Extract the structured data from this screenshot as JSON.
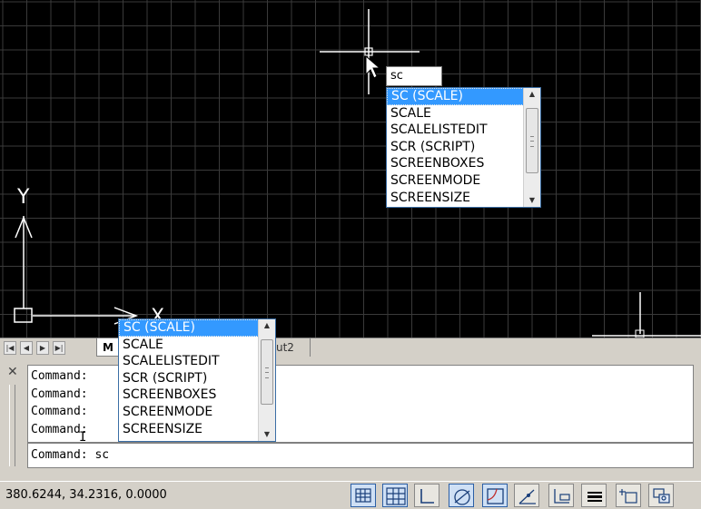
{
  "canvas": {
    "background": "#000000",
    "grid_color": "#3a3a3a",
    "ucs_x_label": "X",
    "ucs_y_label": "Y"
  },
  "autocomplete_top": {
    "input_value": "sc",
    "items": [
      "SC (SCALE)",
      "SCALE",
      "SCALELISTEDIT",
      "SCR (SCRIPT)",
      "SCREENBOXES",
      "SCREENMODE",
      "SCREENSIZE"
    ],
    "selected_index": 0
  },
  "autocomplete_bottom": {
    "items": [
      "SC (SCALE)",
      "SCALE",
      "SCALELISTEDIT",
      "SCR (SCRIPT)",
      "SCREENBOXES",
      "SCREENMODE",
      "SCREENSIZE"
    ],
    "selected_index": 0
  },
  "layout_tabs": {
    "model_label": "M",
    "layout2_label": "ut2",
    "nav_first": "|◀",
    "nav_prev": "◀",
    "nav_next": "▶",
    "nav_last": "▶|"
  },
  "command_panel": {
    "close_glyph": "✕",
    "history": [
      "Command:",
      "Command:",
      "Command:",
      "Command:"
    ],
    "current_line": "Command: sc",
    "cursor_glyph": "I"
  },
  "status_bar": {
    "coordinates": "380.6244, 34.2316, 0.0000",
    "buttons": [
      "snap-mode",
      "grid-display",
      "ortho-mode",
      "polar-tracking",
      "object-snap",
      "object-snap-tracking",
      "dynamic-ucs",
      "dynamic-input",
      "lineweight",
      "model-space",
      "quick-view"
    ],
    "accent_color": "#2b5fa6"
  }
}
